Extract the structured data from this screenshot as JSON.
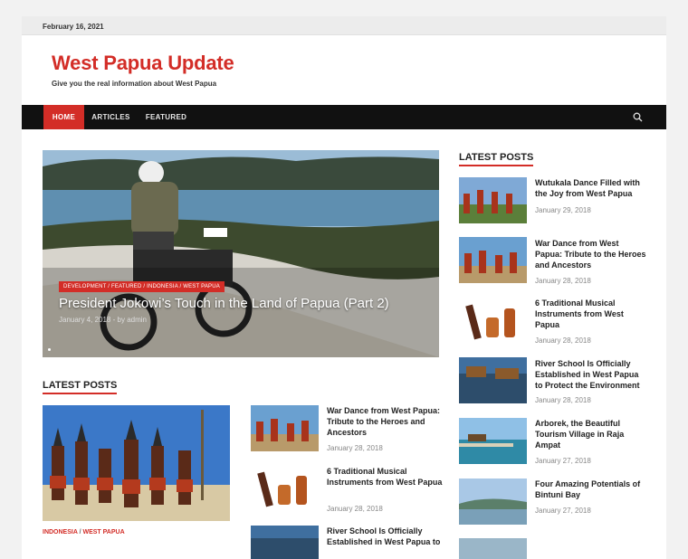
{
  "topbar": {
    "date": "February 16, 2021"
  },
  "header": {
    "site_title": "West Papua Update",
    "tagline": "Give you the real information about West Papua"
  },
  "nav": {
    "items": [
      "HOME",
      "ARTICLES",
      "FEATURED"
    ],
    "search_icon": "search-icon"
  },
  "hero": {
    "categories": "DEVELOPMENT / FEATURED / INDONESIA / WEST PAPUA",
    "title": "President Jokowi’s Touch in the Land of Papua (Part 2)",
    "date": "January 4, 2018",
    "author_prefix": "- by",
    "author": "admin"
  },
  "main": {
    "section_title": "LATEST POSTS",
    "big_post": {
      "cat1": "INDONESIA",
      "sep": " / ",
      "cat2": "WEST PAPUA"
    },
    "posts": [
      {
        "title": "War Dance from West Papua: Tribute to the Heroes and Ancestors",
        "date": "January 28, 2018"
      },
      {
        "title": "6 Traditional Musical Instruments from West Papua",
        "date": "January 28, 2018"
      },
      {
        "title": "River School Is Officially Established in West Papua to",
        "date": ""
      }
    ]
  },
  "sidebar": {
    "section_title": "LATEST POSTS",
    "posts": [
      {
        "title": "Wutukala Dance Filled with the Joy from West Papua",
        "date": "January 29, 2018"
      },
      {
        "title": "War Dance from West Papua: Tribute to the Heroes and Ancestors",
        "date": "January 28, 2018"
      },
      {
        "title": "6 Traditional Musical Instruments from West Papua",
        "date": "January 28, 2018"
      },
      {
        "title": "River School Is Officially Established in West Papua to Protect the Environment",
        "date": "January 28, 2018"
      },
      {
        "title": "Arborek, the Beautiful Tourism Village in Raja Ampat",
        "date": "January 27, 2018"
      },
      {
        "title": "Four Amazing Potentials of Bintuni Bay",
        "date": "January 27, 2018"
      }
    ]
  },
  "colors": {
    "accent": "#d32d27",
    "nav_bg": "#111111"
  }
}
